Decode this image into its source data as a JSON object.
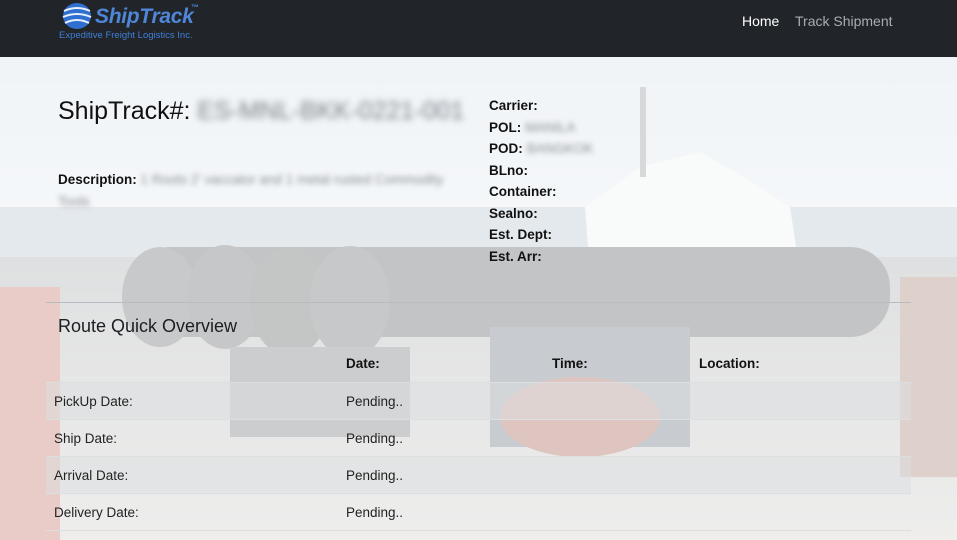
{
  "navbar": {
    "brand_name": "ShipTrack",
    "brand_tm": "™",
    "brand_tagline": "Expeditive Freight Logistics Inc.",
    "links": [
      {
        "label": "Home",
        "active": true
      },
      {
        "label": "Track Shipment",
        "active": false
      }
    ]
  },
  "shipment": {
    "title_label": "ShipTrack#:",
    "tracking_number": "ES-MNL-BKK-0221-001",
    "description_label": "Description:",
    "description_value": "1 Roots 2' vaccator and 1 metal rusted Commodity Tools",
    "details": [
      {
        "label": "Carrier:",
        "value": ""
      },
      {
        "label": "POL:",
        "value": "MANILA"
      },
      {
        "label": "POD:",
        "value": "BANGKOK"
      },
      {
        "label": "BLno:",
        "value": ""
      },
      {
        "label": "Container:",
        "value": ""
      },
      {
        "label": "Sealno:",
        "value": ""
      },
      {
        "label": "Est. Dept:",
        "value": ""
      },
      {
        "label": "Est. Arr:",
        "value": ""
      }
    ]
  },
  "route": {
    "title": "Route Quick Overview",
    "columns": [
      "",
      "Date:",
      "Time:",
      "Location:"
    ],
    "rows": [
      {
        "label": "PickUp Date:",
        "date": "Pending..",
        "time": "",
        "location": ""
      },
      {
        "label": "Ship Date:",
        "date": "Pending..",
        "time": "",
        "location": ""
      },
      {
        "label": "Arrival Date:",
        "date": "Pending..",
        "time": "",
        "location": ""
      },
      {
        "label": "Delivery Date:",
        "date": "Pending..",
        "time": "",
        "location": ""
      }
    ]
  },
  "colors": {
    "navbar_bg": "#212529",
    "brand_blue": "#4f86d8",
    "nav_active": "#ffffff",
    "nav_inactive": "#a9adb1",
    "table_stripe": "#dcdee0"
  },
  "icons": {
    "brand_logo": "globe-icon"
  }
}
